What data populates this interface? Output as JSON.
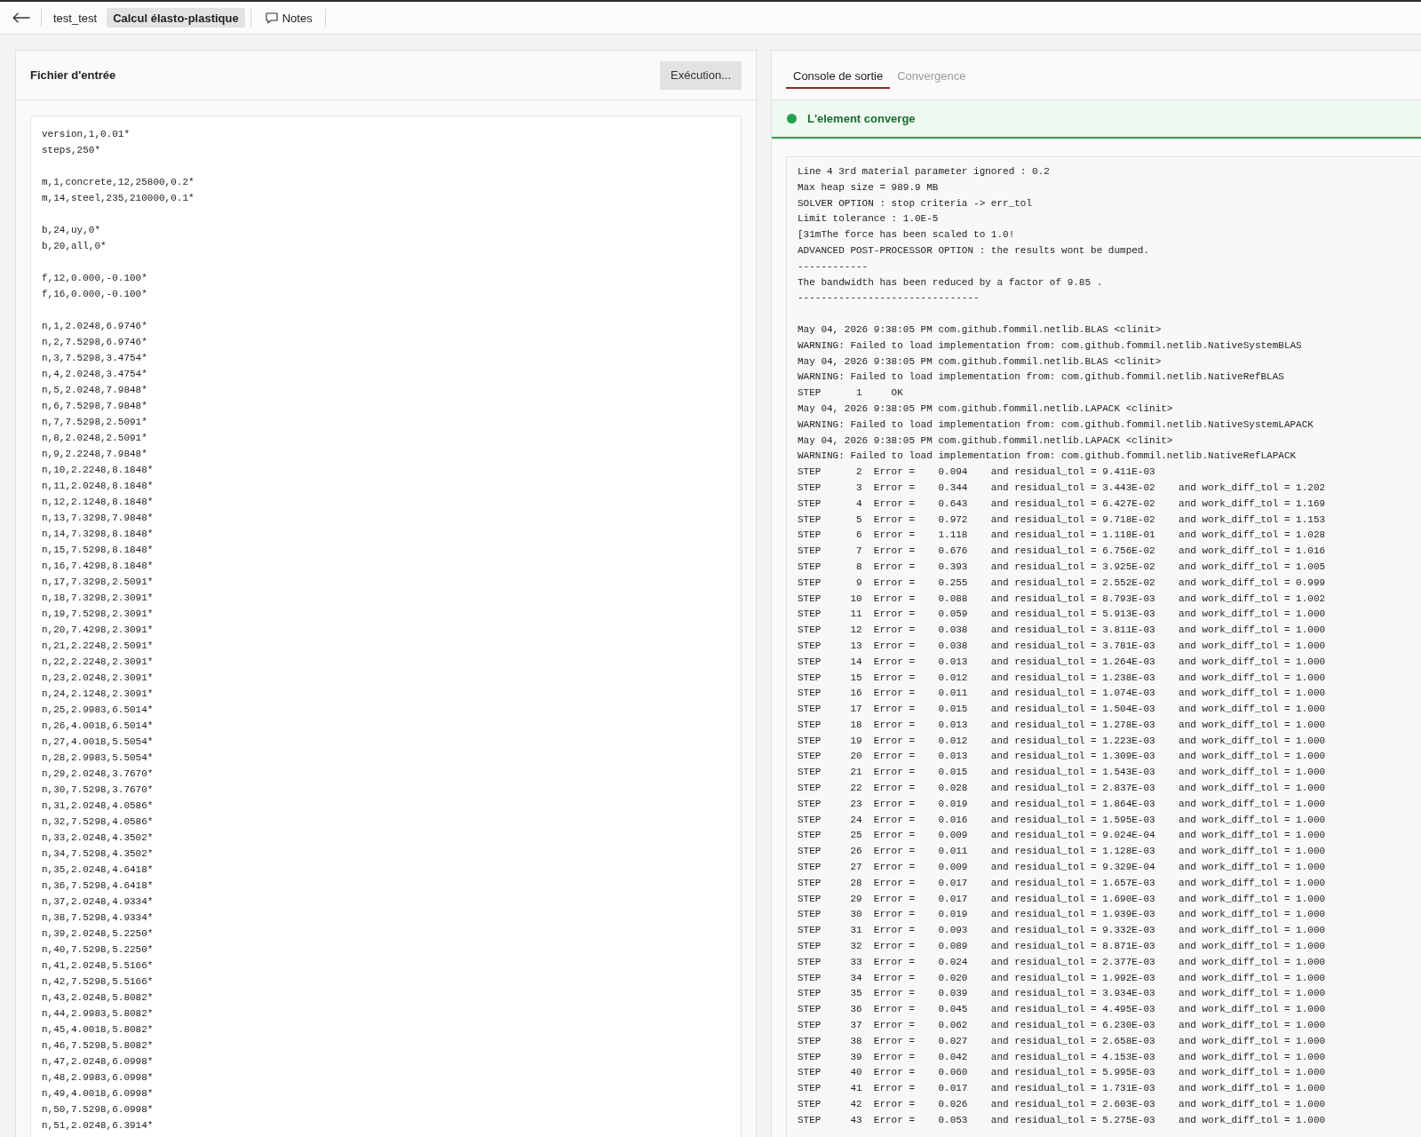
{
  "top_bar": {
    "tabs": [
      {
        "label": "test_test",
        "selected": false
      },
      {
        "label": "Calcul élasto-plastique",
        "selected": true
      }
    ],
    "notes_button": {
      "label": "Notes"
    }
  },
  "input_panel": {
    "title": "Fichier d'entrée",
    "run_button": {
      "label": "Exécution..."
    },
    "editor": {
      "blocks": [
        [
          "version,1,0.01*",
          "steps,250*"
        ],
        [
          "m,1,concrete,12,25800,0.2*",
          "m,14,steel,235,210000,0.1*"
        ],
        [
          "b,24,uy,0*",
          "b,20,all,0*"
        ],
        [
          "f,12,0.000,-0.100*",
          "f,16,0.000,-0.100*"
        ],
        [
          "n,1,2.0248,6.9746*",
          "n,2,7.5298,6.9746*",
          "n,3,7.5298,3.4754*",
          "n,4,2.0248,3.4754*",
          "n,5,2.0248,7.9848*",
          "n,6,7.5298,7.9848*",
          "n,7,7.5298,2.5091*",
          "n,8,2.0248,2.5091*",
          "n,9,2.2248,7.9848*",
          "n,10,2.2248,8.1848*",
          "n,11,2.0248,8.1848*",
          "n,12,2.1248,8.1848*",
          "n,13,7.3298,7.9848*",
          "n,14,7.3298,8.1848*",
          "n,15,7.5298,8.1848*",
          "n,16,7.4298,8.1848*",
          "n,17,7.3298,2.5091*",
          "n,18,7.3298,2.3091*",
          "n,19,7.5298,2.3091*",
          "n,20,7.4298,2.3091*",
          "n,21,2.2248,2.5091*",
          "n,22,2.2248,2.3091*",
          "n,23,2.0248,2.3091*",
          "n,24,2.1248,2.3091*",
          "n,25,2.9983,6.5014*",
          "n,26,4.0018,6.5014*",
          "n,27,4.0018,5.5054*",
          "n,28,2.9983,5.5054*",
          "n,29,2.0248,3.7670*",
          "n,30,7.5298,3.7670*",
          "n,31,2.0248,4.0586*",
          "n,32,7.5298,4.0586*",
          "n,33,2.0248,4.3502*",
          "n,34,7.5298,4.3502*",
          "n,35,2.0248,4.6418*",
          "n,36,7.5298,4.6418*",
          "n,37,2.0248,4.9334*",
          "n,38,7.5298,4.9334*",
          "n,39,2.0248,5.2250*",
          "n,40,7.5298,5.2250*",
          "n,41,2.0248,5.5166*",
          "n,42,7.5298,5.5166*",
          "n,43,2.0248,5.8082*",
          "n,44,2.9983,5.8082*",
          "n,45,4.0018,5.8082*",
          "n,46,7.5298,5.8082*",
          "n,47,2.0248,6.0998*",
          "n,48,2.9983,6.0998*",
          "n,49,4.0018,6.0998*",
          "n,50,7.5298,6.0998*",
          "n,51,2.0248,6.3914*"
        ]
      ]
    }
  },
  "output_panel": {
    "tabs": [
      {
        "label": "Console de sortie",
        "selected": true
      },
      {
        "label": "Convergence",
        "selected": false
      }
    ],
    "banner": {
      "kind": "success",
      "text": "L'element converge"
    },
    "console": {
      "blocks": [
        [
          "Line 4 3rd material parameter ignored : 0.2",
          "Max heap size = 989.9 MB",
          "SOLVER OPTION : stop criteria -> err_tol",
          "Limit tolerance : 1.0E-5",
          "[31mThe force has been scaled to 1.0!",
          "ADVANCED POST-PROCESSOR OPTION : the results wont be dumped.",
          "------------",
          "The bandwidth has been reduced by a factor of 9.85 .",
          "-------------------------------"
        ],
        [
          "May 04, 2026 9:38:05 PM com.github.fommil.netlib.BLAS <clinit>",
          "WARNING: Failed to load implementation from: com.github.fommil.netlib.NativeSystemBLAS",
          "May 04, 2026 9:38:05 PM com.github.fommil.netlib.BLAS <clinit>",
          "WARNING: Failed to load implementation from: com.github.fommil.netlib.NativeRefBLAS",
          "STEP      1     OK",
          "May 04, 2026 9:38:05 PM com.github.fommil.netlib.LAPACK <clinit>",
          "WARNING: Failed to load implementation from: com.github.fommil.netlib.NativeSystemLAPACK",
          "May 04, 2026 9:38:05 PM com.github.fommil.netlib.LAPACK <clinit>",
          "WARNING: Failed to load implementation from: com.github.fommil.netlib.NativeRefLAPACK",
          "STEP      2  Error =    0.094    and residual_tol = 9.411E-03",
          "STEP      3  Error =    0.344    and residual_tol = 3.443E-02    and work_diff_tol = 1.202",
          "STEP      4  Error =    0.643    and residual_tol = 6.427E-02    and work_diff_tol = 1.169",
          "STEP      5  Error =    0.972    and residual_tol = 9.718E-02    and work_diff_tol = 1.153",
          "STEP      6  Error =    1.118    and residual_tol = 1.118E-01    and work_diff_tol = 1.028",
          "STEP      7  Error =    0.676    and residual_tol = 6.756E-02    and work_diff_tol = 1.016",
          "STEP      8  Error =    0.393    and residual_tol = 3.925E-02    and work_diff_tol = 1.005",
          "STEP      9  Error =    0.255    and residual_tol = 2.552E-02    and work_diff_tol = 0.999",
          "STEP     10  Error =    0.088    and residual_tol = 8.793E-03    and work_diff_tol = 1.002",
          "STEP     11  Error =    0.059    and residual_tol = 5.913E-03    and work_diff_tol = 1.000",
          "STEP     12  Error =    0.038    and residual_tol = 3.811E-03    and work_diff_tol = 1.000",
          "STEP     13  Error =    0.038    and residual_tol = 3.781E-03    and work_diff_tol = 1.000",
          "STEP     14  Error =    0.013    and residual_tol = 1.264E-03    and work_diff_tol = 1.000",
          "STEP     15  Error =    0.012    and residual_tol = 1.238E-03    and work_diff_tol = 1.000",
          "STEP     16  Error =    0.011    and residual_tol = 1.074E-03    and work_diff_tol = 1.000",
          "STEP     17  Error =    0.015    and residual_tol = 1.504E-03    and work_diff_tol = 1.000",
          "STEP     18  Error =    0.013    and residual_tol = 1.278E-03    and work_diff_tol = 1.000",
          "STEP     19  Error =    0.012    and residual_tol = 1.223E-03    and work_diff_tol = 1.000",
          "STEP     20  Error =    0.013    and residual_tol = 1.309E-03    and work_diff_tol = 1.000",
          "STEP     21  Error =    0.015    and residual_tol = 1.543E-03    and work_diff_tol = 1.000",
          "STEP     22  Error =    0.028    and residual_tol = 2.837E-03    and work_diff_tol = 1.000",
          "STEP     23  Error =    0.019    and residual_tol = 1.864E-03    and work_diff_tol = 1.000",
          "STEP     24  Error =    0.016    and residual_tol = 1.595E-03    and work_diff_tol = 1.000",
          "STEP     25  Error =    0.009    and residual_tol = 9.024E-04    and work_diff_tol = 1.000",
          "STEP     26  Error =    0.011    and residual_tol = 1.128E-03    and work_diff_tol = 1.000",
          "STEP     27  Error =    0.009    and residual_tol = 9.329E-04    and work_diff_tol = 1.000",
          "STEP     28  Error =    0.017    and residual_tol = 1.657E-03    and work_diff_tol = 1.000",
          "STEP     29  Error =    0.017    and residual_tol = 1.690E-03    and work_diff_tol = 1.000",
          "STEP     30  Error =    0.019    and residual_tol = 1.939E-03    and work_diff_tol = 1.000",
          "STEP     31  Error =    0.093    and residual_tol = 9.332E-03    and work_diff_tol = 1.000",
          "STEP     32  Error =    0.089    and residual_tol = 8.871E-03    and work_diff_tol = 1.000",
          "STEP     33  Error =    0.024    and residual_tol = 2.377E-03    and work_diff_tol = 1.000",
          "STEP     34  Error =    0.020    and residual_tol = 1.992E-03    and work_diff_tol = 1.000",
          "STEP     35  Error =    0.039    and residual_tol = 3.934E-03    and work_diff_tol = 1.000",
          "STEP     36  Error =    0.045    and residual_tol = 4.495E-03    and work_diff_tol = 1.000",
          "STEP     37  Error =    0.062    and residual_tol = 6.230E-03    and work_diff_tol = 1.000",
          "STEP     38  Error =    0.027    and residual_tol = 2.658E-03    and work_diff_tol = 1.000",
          "STEP     39  Error =    0.042    and residual_tol = 4.153E-03    and work_diff_tol = 1.000",
          "STEP     40  Error =    0.060    and residual_tol = 5.995E-03    and work_diff_tol = 1.000",
          "STEP     41  Error =    0.017    and residual_tol = 1.731E-03    and work_diff_tol = 1.000",
          "STEP     42  Error =    0.026    and residual_tol = 2.603E-03    and work_diff_tol = 1.000",
          "STEP     43  Error =    0.053    and residual_tol = 5.275E-03    and work_diff_tol = 1.000"
        ]
      ]
    }
  }
}
